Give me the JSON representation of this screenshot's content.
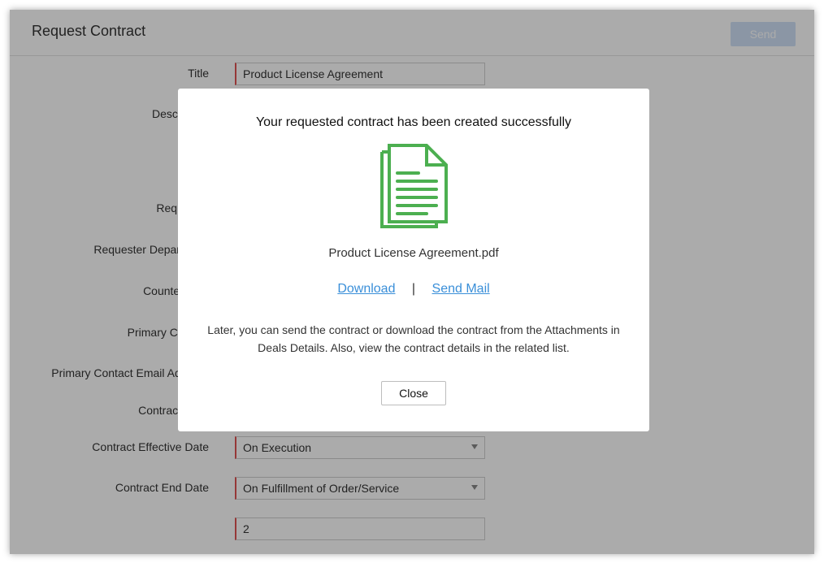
{
  "header": {
    "title": "Request Contract",
    "send_label": "Send"
  },
  "form": {
    "title_label": "Title",
    "title_value": "Product License Agreement",
    "description_label": "Description",
    "requester_label": "Requester",
    "requester_department_label": "Requester Department",
    "counterparty_label": "Counterparty",
    "primary_contact_label": "Primary Contact",
    "primary_contact_email_label": "Primary Contact Email Address",
    "contract_type_label": "Contract Type",
    "effective_date_label": "Contract Effective Date",
    "effective_date_value": "On Execution",
    "end_date_label": "Contract End Date",
    "end_date_value": "On Fulfillment of Order/Service",
    "extra_value": "2"
  },
  "modal": {
    "title": "Your requested contract has been created successfully",
    "icon": "document-icon",
    "file_name": "Product License Agreement.pdf",
    "download_label": "Download",
    "separator": "|",
    "send_mail_label": "Send Mail",
    "info_line1": "Later, you can send the contract or download the contract from the Attachments in",
    "info_line2": "Deals Details. Also, view the contract details in the related list.",
    "close_label": "Close"
  },
  "colors": {
    "accent_link": "#3a8fd9",
    "icon_green": "#4caf50",
    "required_marker": "#e05252",
    "send_button": "#cfe0f6"
  }
}
